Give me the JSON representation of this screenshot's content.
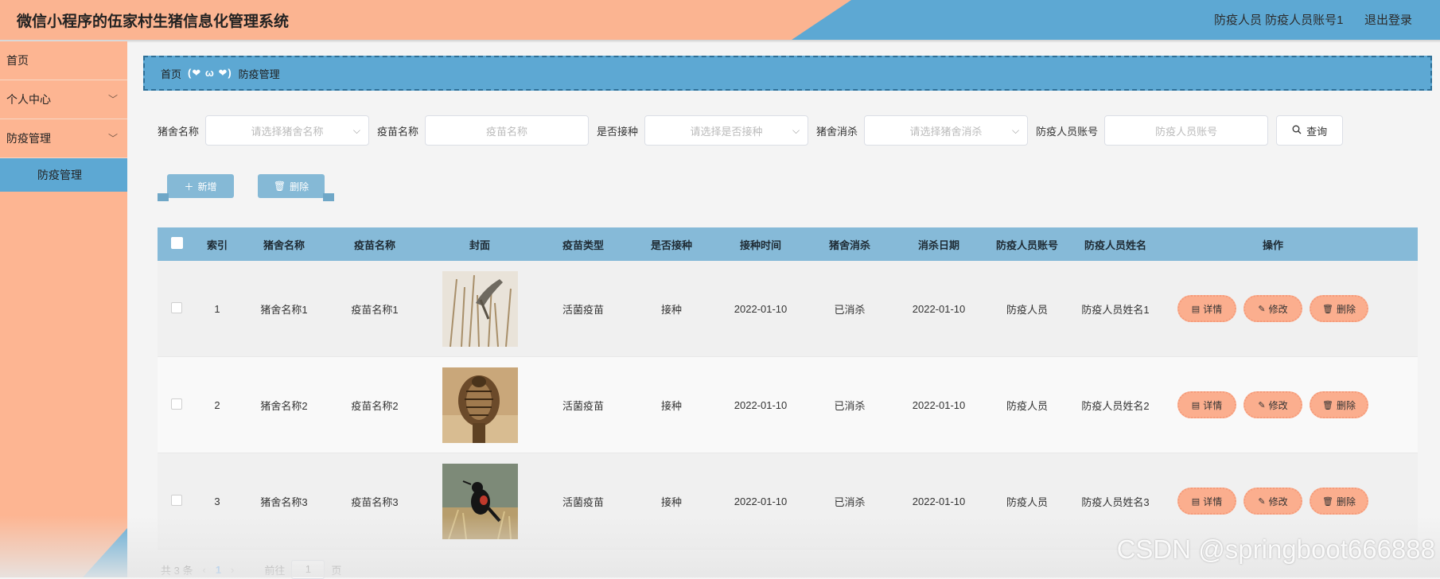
{
  "header": {
    "title": "微信小程序的伍家村生猪信息化管理系统",
    "user": "防疫人员 防疫人员账号1",
    "logout": "退出登录"
  },
  "sidebar": {
    "items": [
      {
        "label": "首页"
      },
      {
        "label": "个人中心"
      },
      {
        "label": "防疫管理"
      }
    ],
    "sub_active": "防疫管理"
  },
  "breadcrumb": {
    "home": "首页",
    "sep": "(❤ ω ❤)",
    "current": "防疫管理"
  },
  "search": {
    "f1_label": "猪舍名称",
    "f1_placeholder": "请选择猪舍名称",
    "f2_label": "疫苗名称",
    "f2_placeholder": "疫苗名称",
    "f3_label": "是否接种",
    "f3_placeholder": "请选择是否接种",
    "f4_label": "猪舍消杀",
    "f4_placeholder": "请选择猪舍消杀",
    "f5_label": "防疫人员账号",
    "f5_placeholder": "防疫人员账号",
    "button": "查询"
  },
  "actions": {
    "add": "新增",
    "delete": "删除"
  },
  "table": {
    "columns": [
      "索引",
      "猪舍名称",
      "疫苗名称",
      "封面",
      "疫苗类型",
      "是否接种",
      "接种时间",
      "猪舍消杀",
      "消杀日期",
      "防疫人员账号",
      "防疫人员姓名",
      "操作"
    ],
    "rows": [
      {
        "index": "1",
        "pen": "猪舍名称1",
        "vaccine": "疫苗名称1",
        "type": "活菌疫苗",
        "vaccinated": "接种",
        "time": "2022-01-10",
        "disinfect": "已消杀",
        "date": "2022-01-10",
        "account": "防疫人员",
        "name": "防疫人员姓名1"
      },
      {
        "index": "2",
        "pen": "猪舍名称2",
        "vaccine": "疫苗名称2",
        "type": "活菌疫苗",
        "vaccinated": "接种",
        "time": "2022-01-10",
        "disinfect": "已消杀",
        "date": "2022-01-10",
        "account": "防疫人员",
        "name": "防疫人员姓名2"
      },
      {
        "index": "3",
        "pen": "猪舍名称3",
        "vaccine": "疫苗名称3",
        "type": "活菌疫苗",
        "vaccinated": "接种",
        "time": "2022-01-10",
        "disinfect": "已消杀",
        "date": "2022-01-10",
        "account": "防疫人员",
        "name": "防疫人员姓名3"
      }
    ],
    "op_detail": "详情",
    "op_edit": "修改",
    "op_delete": "删除"
  },
  "pager": {
    "total": "共 3 条",
    "current": "1",
    "goto_label": "前往",
    "page_input": "1",
    "page_suffix": "页"
  },
  "watermark": "CSDN @springboot666888"
}
